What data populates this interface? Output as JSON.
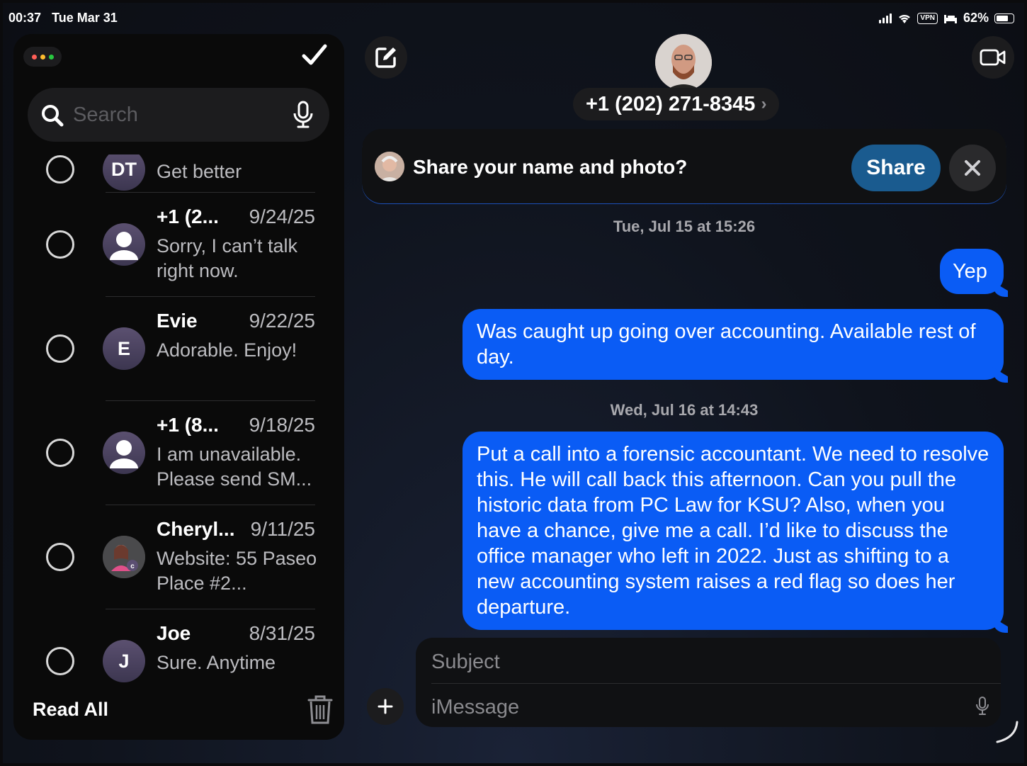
{
  "status_bar": {
    "time": "00:37",
    "date": "Tue Mar 31",
    "vpn": "VPN",
    "battery": "62%"
  },
  "sidebar": {
    "search_placeholder": "Search",
    "read_all_label": "Read All",
    "conversations": [
      {
        "initials": "DT",
        "name": "",
        "date": "",
        "preview": "Get better",
        "avatar": "initials"
      },
      {
        "initials": "",
        "name": "+1 (2...",
        "date": "9/24/25",
        "preview": "Sorry, I can’t talk right now.",
        "avatar": "person"
      },
      {
        "initials": "E",
        "name": "Evie",
        "date": "9/22/25",
        "preview": "Adorable. Enjoy!",
        "avatar": "initials"
      },
      {
        "initials": "",
        "name": "+1 (8...",
        "date": "9/18/25",
        "preview": "I am unavailable. Please send SM...",
        "avatar": "person"
      },
      {
        "initials": "",
        "name": "Cheryl...",
        "date": "9/11/25",
        "preview": "Website: 55 Paseo Place #2...",
        "avatar": "photo",
        "badge": "c"
      },
      {
        "initials": "J",
        "name": "Joe",
        "date": "8/31/25",
        "preview": "Sure. Anytime",
        "avatar": "initials"
      }
    ]
  },
  "conversation": {
    "contact_number": "+1 (202) 271-8345",
    "share_banner": {
      "text": "Share your name and photo?",
      "share_label": "Share"
    },
    "messages": [
      {
        "type": "timestamp",
        "text": "Tue, Jul 15 at 15:26"
      },
      {
        "type": "sent",
        "text": "Yep"
      },
      {
        "type": "sent",
        "text": "Was caught up going over accounting. Available rest of day."
      },
      {
        "type": "timestamp",
        "text": "Wed, Jul 16 at 14:43"
      },
      {
        "type": "sent",
        "text": "Put a call into a forensic accountant. We need to resolve this. He will call back this afternoon. Can you pull the historic data from PC Law for KSU? Also, when you have a chance, give me a call. I’d like to discuss the office manager who left  in 2022.  Just as shifting to a new accounting system raises a red flag  so does her departure."
      }
    ],
    "subject_placeholder": "Subject",
    "message_placeholder": "iMessage"
  },
  "colors": {
    "bubble_blue": "#0a5cf5",
    "share_button": "#1a5b8f",
    "traffic_red": "#ff5f57",
    "traffic_yellow": "#febc2e",
    "traffic_green": "#28c840"
  }
}
